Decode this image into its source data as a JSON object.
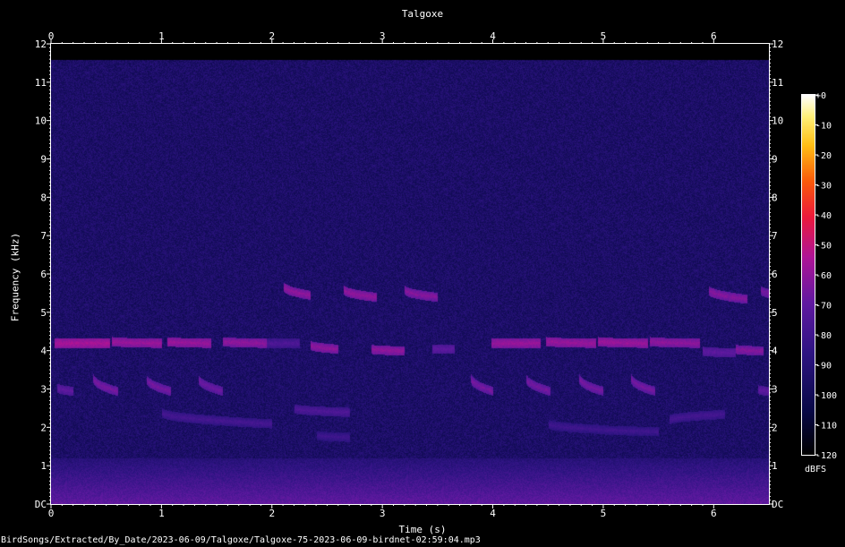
{
  "chart_data": {
    "type": "heatmap",
    "title": "Talgoxe",
    "xlabel": "Time (s)",
    "ylabel": "Frequency (kHz)",
    "x_range": [
      0,
      6.5
    ],
    "y_range": [
      0,
      12
    ],
    "x_ticks": [
      "0",
      "1",
      "2",
      "3",
      "4",
      "5",
      "6"
    ],
    "y_ticks": [
      "DC",
      "1",
      "2",
      "3",
      "4",
      "5",
      "6",
      "7",
      "8",
      "9",
      "10",
      "11",
      "12"
    ],
    "colorbar": {
      "unit": "dBFS",
      "range": [
        -120,
        0
      ],
      "ticks": [
        "+0",
        "-10",
        "-20",
        "-30",
        "-40",
        "-50",
        "-60",
        "-70",
        "-80",
        "-90",
        "-100",
        "-110",
        "-120"
      ]
    },
    "signal_cutoff_khz": 11.6,
    "background_db": -95,
    "low_band_db": -70,
    "calls": [
      {
        "t": 0.03,
        "dur": 0.5,
        "f0": 4.2,
        "f1": 4.2,
        "db": -55
      },
      {
        "t": 0.55,
        "dur": 0.45,
        "f0": 4.25,
        "f1": 4.2,
        "db": -58
      },
      {
        "t": 1.05,
        "dur": 0.4,
        "f0": 4.25,
        "f1": 4.2,
        "db": -58
      },
      {
        "t": 1.55,
        "dur": 0.4,
        "f0": 4.25,
        "f1": 4.2,
        "db": -60
      },
      {
        "t": 1.95,
        "dur": 0.3,
        "f0": 4.2,
        "f1": 4.2,
        "db": -75
      },
      {
        "t": 0.05,
        "dur": 0.15,
        "f0": 3.05,
        "f1": 2.95,
        "db": -70
      },
      {
        "t": 0.38,
        "dur": 0.22,
        "f0": 3.3,
        "f1": 2.95,
        "db": -65
      },
      {
        "t": 0.86,
        "dur": 0.22,
        "f0": 3.3,
        "f1": 2.95,
        "db": -65
      },
      {
        "t": 1.33,
        "dur": 0.22,
        "f0": 3.3,
        "f1": 2.95,
        "db": -67
      },
      {
        "t": 2.1,
        "dur": 0.25,
        "f0": 5.7,
        "f1": 5.45,
        "db": -60
      },
      {
        "t": 2.65,
        "dur": 0.3,
        "f0": 5.6,
        "f1": 5.4,
        "db": -60
      },
      {
        "t": 3.2,
        "dur": 0.3,
        "f0": 5.6,
        "f1": 5.4,
        "db": -62
      },
      {
        "t": 2.35,
        "dur": 0.25,
        "f0": 4.15,
        "f1": 4.05,
        "db": -60
      },
      {
        "t": 2.9,
        "dur": 0.3,
        "f0": 4.05,
        "f1": 4.0,
        "db": -60
      },
      {
        "t": 3.45,
        "dur": 0.2,
        "f0": 4.05,
        "f1": 4.05,
        "db": -70
      },
      {
        "t": 3.98,
        "dur": 0.45,
        "f0": 4.2,
        "f1": 4.2,
        "db": -58
      },
      {
        "t": 4.48,
        "dur": 0.45,
        "f0": 4.25,
        "f1": 4.2,
        "db": -58
      },
      {
        "t": 4.95,
        "dur": 0.45,
        "f0": 4.25,
        "f1": 4.2,
        "db": -58
      },
      {
        "t": 5.42,
        "dur": 0.45,
        "f0": 4.25,
        "f1": 4.2,
        "db": -60
      },
      {
        "t": 5.9,
        "dur": 0.3,
        "f0": 4.0,
        "f1": 3.95,
        "db": -70
      },
      {
        "t": 6.2,
        "dur": 0.25,
        "f0": 4.05,
        "f1": 4.0,
        "db": -62
      },
      {
        "t": 3.8,
        "dur": 0.2,
        "f0": 3.3,
        "f1": 2.95,
        "db": -65
      },
      {
        "t": 4.3,
        "dur": 0.22,
        "f0": 3.3,
        "f1": 2.95,
        "db": -65
      },
      {
        "t": 4.78,
        "dur": 0.22,
        "f0": 3.3,
        "f1": 2.95,
        "db": -65
      },
      {
        "t": 5.25,
        "dur": 0.22,
        "f0": 3.3,
        "f1": 2.95,
        "db": -65
      },
      {
        "t": 6.4,
        "dur": 0.1,
        "f0": 3.0,
        "f1": 2.95,
        "db": -70
      },
      {
        "t": 5.95,
        "dur": 0.35,
        "f0": 5.6,
        "f1": 5.35,
        "db": -62
      },
      {
        "t": 6.42,
        "dur": 0.08,
        "f0": 5.6,
        "f1": 5.5,
        "db": -65
      },
      {
        "t": 1.0,
        "dur": 1.0,
        "f0": 2.4,
        "f1": 2.1,
        "db": -78
      },
      {
        "t": 2.2,
        "dur": 0.5,
        "f0": 2.5,
        "f1": 2.4,
        "db": -75
      },
      {
        "t": 2.4,
        "dur": 0.3,
        "f0": 1.8,
        "f1": 1.75,
        "db": -80
      },
      {
        "t": 4.5,
        "dur": 0.5,
        "f0": 2.1,
        "f1": 1.95,
        "db": -80
      },
      {
        "t": 5.0,
        "dur": 0.5,
        "f0": 1.95,
        "f1": 1.9,
        "db": -80
      },
      {
        "t": 5.6,
        "dur": 0.5,
        "f0": 2.2,
        "f1": 2.35,
        "db": -78
      }
    ]
  },
  "footer_path": "BirdSongs/Extracted/By_Date/2023-06-09/Talgoxe/Talgoxe-75-2023-06-09-birdnet-02:59:04.mp3"
}
